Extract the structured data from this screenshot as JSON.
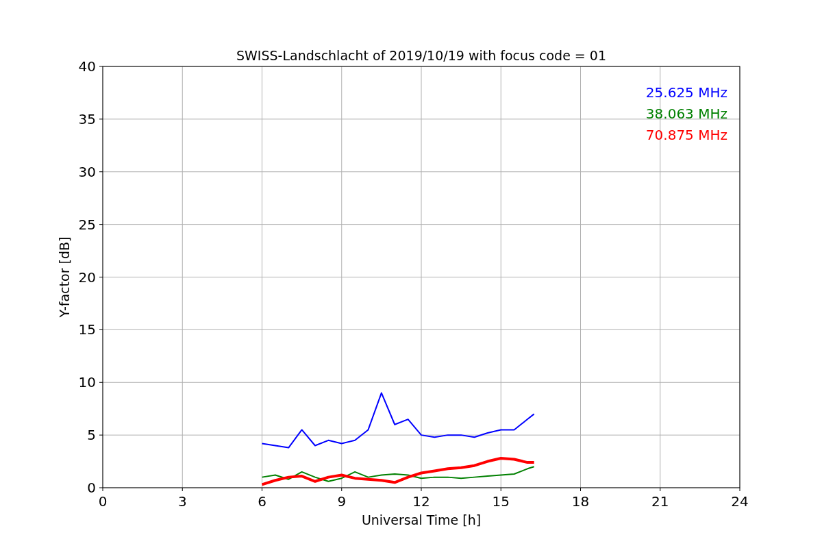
{
  "chart_data": {
    "type": "line",
    "title": "SWISS-Landschlacht of 2019/10/19 with focus code = 01",
    "xlabel": "Universal Time [h]",
    "ylabel": "Y-factor [dB]",
    "x": [
      6,
      6.5,
      7,
      7.5,
      8,
      8.5,
      9,
      9.5,
      10,
      10.5,
      11,
      11.5,
      12,
      12.5,
      13,
      13.5,
      14,
      14.5,
      15,
      15.5,
      16,
      16.25
    ],
    "series": [
      {
        "name": "25.625 MHz",
        "color": "#0000ff",
        "values": [
          4.2,
          4.0,
          3.8,
          5.5,
          4.0,
          4.5,
          4.2,
          4.5,
          5.5,
          9,
          6,
          6.5,
          5,
          4.8,
          5,
          5,
          4.8,
          5.2,
          5.5,
          5.5,
          6.5,
          7
        ]
      },
      {
        "name": "38.063 MHz",
        "color": "#008000",
        "values": [
          1.0,
          1.2,
          0.8,
          1.5,
          1.0,
          0.6,
          0.9,
          1.5,
          1.0,
          1.2,
          1.3,
          1.2,
          0.9,
          1.0,
          1.0,
          0.9,
          1.0,
          1.1,
          1.2,
          1.3,
          1.8,
          2.0
        ]
      },
      {
        "name": "70.875 MHz",
        "color": "#ff0000",
        "values": [
          0.3,
          0.7,
          1.0,
          1.1,
          0.6,
          1.0,
          1.2,
          0.9,
          0.8,
          0.7,
          0.5,
          1.0,
          1.4,
          1.6,
          1.8,
          1.9,
          2.1,
          2.5,
          2.8,
          2.7,
          2.4,
          2.4
        ]
      }
    ],
    "xlim": [
      0,
      24
    ],
    "ylim": [
      0,
      40
    ],
    "xticks": [
      0,
      3,
      6,
      9,
      12,
      15,
      18,
      21,
      24
    ],
    "yticks": [
      0,
      5,
      10,
      15,
      20,
      25,
      30,
      35,
      40
    ],
    "grid": true
  }
}
